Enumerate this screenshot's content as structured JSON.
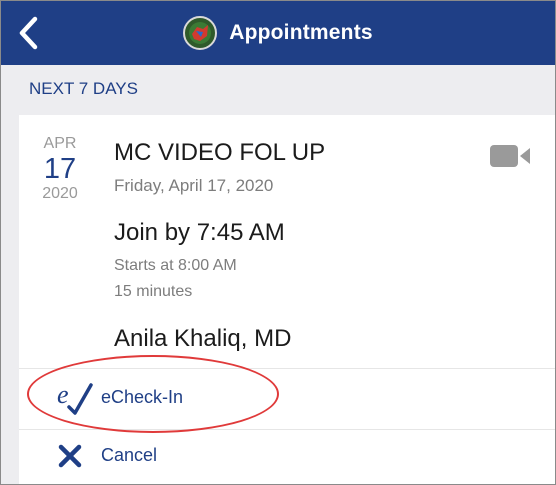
{
  "header": {
    "title": "Appointments",
    "back_icon": "chevron-left-icon",
    "logo_icon": "app-logo-icon",
    "bg_color": "#1f3f86"
  },
  "section": {
    "label": "NEXT 7 DAYS"
  },
  "appointment": {
    "date": {
      "month": "APR",
      "day": "17",
      "year": "2020"
    },
    "title": "MC VIDEO FOL UP",
    "full_date": "Friday, April 17, 2020",
    "join_by": "Join by 7:45 AM",
    "starts_at": "Starts at 8:00 AM",
    "duration": "15 minutes",
    "provider": "Anila Khaliq, MD",
    "type_icon": "video-camera-icon"
  },
  "actions": [
    {
      "label": "eCheck-In",
      "icon": "echeck-in-icon",
      "highlighted": true
    },
    {
      "label": "Cancel",
      "icon": "close-icon"
    }
  ],
  "colors": {
    "accent": "#1f3f86",
    "highlight": "#e03a3a"
  }
}
